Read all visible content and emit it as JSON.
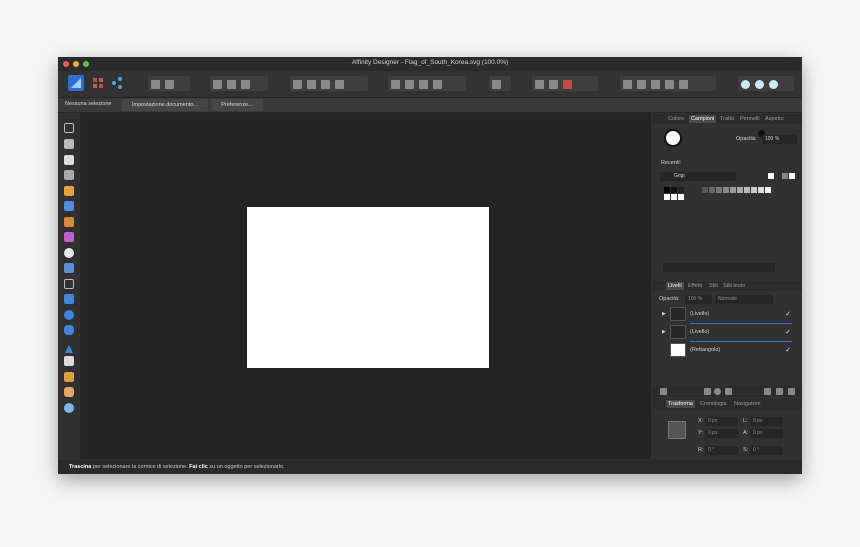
{
  "window": {
    "title": "Affinity Designer - Flag_of_South_Korea.svg (100.0%)"
  },
  "context_toolbar": {
    "selection": "Nessuna selezione",
    "doc_setup": "Impostazione documento...",
    "preferences": "Preferenze..."
  },
  "status": {
    "part1_bold": "Trascina",
    "part2": " per selezionare la cornice di selezione. ",
    "part3_bold": "Fai clic",
    "part4": " su un oggetto per selezionarlo."
  },
  "color_panel": {
    "tabs": [
      "Colore",
      "Campioni",
      "Tratto",
      "Pennelli",
      "Aspetto"
    ],
    "active_tab": "Campioni",
    "opacity_label": "Opacità:",
    "opacity_value": "100 %",
    "recent_label": "Recenti:",
    "palette_name": "Grigi"
  },
  "layers_panel": {
    "tabs": [
      "Livelli",
      "Effetti",
      "Stili",
      "Stili testo"
    ],
    "active_tab": "Livelli",
    "opacity_label": "Opacità:",
    "opacity_value": "100 %",
    "blend_mode": "Normale",
    "layers": [
      {
        "name": "(Livello)",
        "expandable": true,
        "visible": true
      },
      {
        "name": "(Livello)",
        "expandable": true,
        "visible": true
      },
      {
        "name": "(Rettangolo)",
        "expandable": false,
        "visible": true
      }
    ],
    "check_mark": "✓",
    "expand_arrow": "▶"
  },
  "transform_panel": {
    "tabs": [
      "Trasforma",
      "Cronologia",
      "Navigatore"
    ],
    "active_tab": "Trasforma",
    "x_label": "X:",
    "x_value": "0 px",
    "y_label": "Y:",
    "y_value": "0 px",
    "w_label": "L:",
    "w_value": "0 px",
    "h_label": "A:",
    "h_value": "0 px",
    "r_label": "R:",
    "r_value": "0 °",
    "s_label": "S:",
    "s_value": "0 °"
  },
  "colors": {
    "accent": "#2f6fd0",
    "canvas": "#242424",
    "page": "#ffffff"
  },
  "icons": [
    "move-tool-icon",
    "artboard-tool-icon",
    "node-tool-icon",
    "pen-tool-icon",
    "pencil-tool-icon",
    "brush-tool-icon",
    "fill-tool-icon",
    "transparency-tool-icon",
    "crop-tool-icon",
    "rectangle-tool-icon",
    "ellipse-tool-icon",
    "triangle-tool-icon",
    "text-tool-icon",
    "color-picker-icon",
    "hand-tool-icon",
    "zoom-tool-icon"
  ]
}
